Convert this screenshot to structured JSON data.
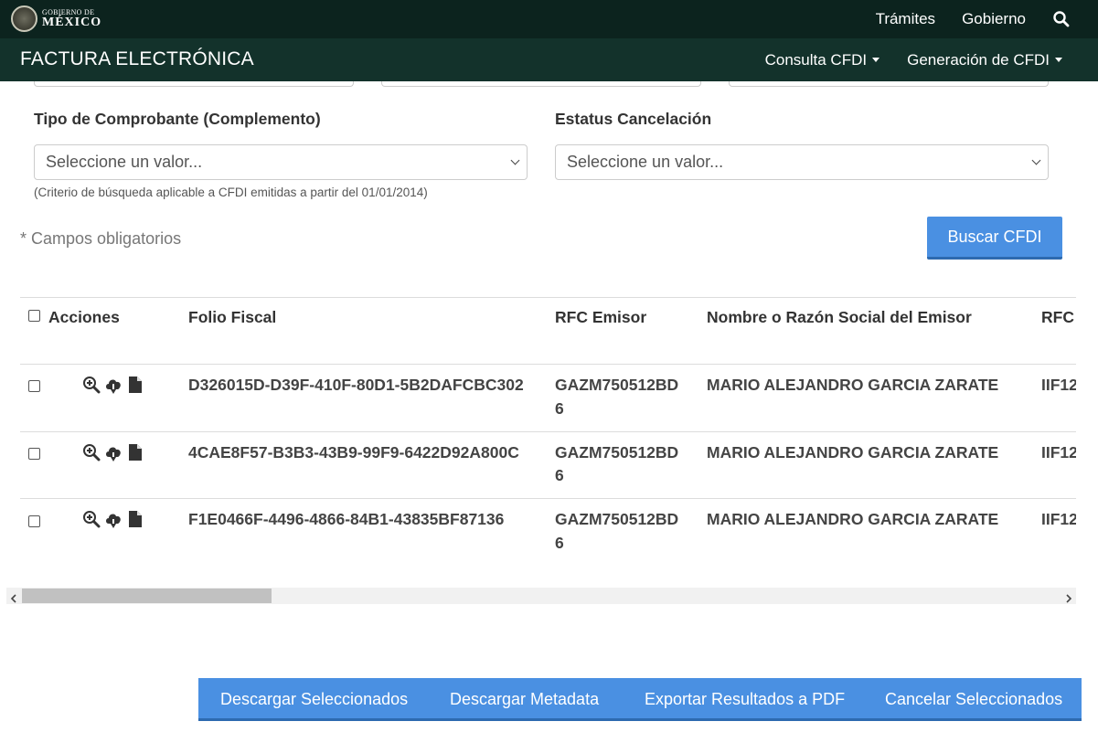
{
  "header": {
    "logo_small": "GOBIERNO DE",
    "logo_big": "MÉXICO",
    "nav": [
      "Trámites",
      "Gobierno"
    ],
    "search_icon": "search-icon"
  },
  "subheader": {
    "title": "FACTURA ELECTRÓNICA",
    "menus": [
      "Consulta CFDI",
      "Generación de CFDI"
    ]
  },
  "form": {
    "tipo_label": "Tipo de Comprobante (Complemento)",
    "tipo_value": "Seleccione un valor...",
    "estatus_label": "Estatus Cancelación",
    "estatus_value": "Seleccione un valor...",
    "hint": "(Criterio de búsqueda aplicable a CFDI emitidas a partir del 01/01/2014)",
    "required": "* Campos obligatorios",
    "search_button": "Buscar CFDI"
  },
  "table": {
    "headers": [
      "Acciones",
      "Folio Fiscal",
      "RFC Emisor",
      "Nombre o Razón Social del Emisor",
      "RFC"
    ],
    "rows": [
      {
        "folio": "D326015D-D39F-410F-80D1-5B2DAFCBC302",
        "rfc_line1": "GAZM750512BD",
        "rfc_line2": "6",
        "nombre": "MARIO ALEJANDRO GARCIA ZARATE",
        "rfc_receptor": "IIF12"
      },
      {
        "folio": "4CAE8F57-B3B3-43B9-99F9-6422D92A800C",
        "rfc_line1": "GAZM750512BD",
        "rfc_line2": "6",
        "nombre": "MARIO ALEJANDRO GARCIA ZARATE",
        "rfc_receptor": "IIF12"
      },
      {
        "folio": "F1E0466F-4496-4866-84B1-43835BF87136",
        "rfc_line1": "GAZM750512BD",
        "rfc_line2": "6",
        "nombre": "MARIO ALEJANDRO GARCIA ZARATE",
        "rfc_receptor": "IIF12"
      }
    ],
    "row_icons": [
      "zoom-in-icon",
      "cloud-download-icon",
      "document-icon"
    ]
  },
  "actions": {
    "download_selected": "Descargar Seleccionados",
    "download_metadata": "Descargar Metadata",
    "export_pdf": "Exportar Resultados a PDF",
    "cancel_selected": "Cancelar Seleccionados"
  },
  "colors": {
    "topbar": "#0c231e",
    "subbar": "#13322b",
    "primary": "#4a90e2"
  }
}
